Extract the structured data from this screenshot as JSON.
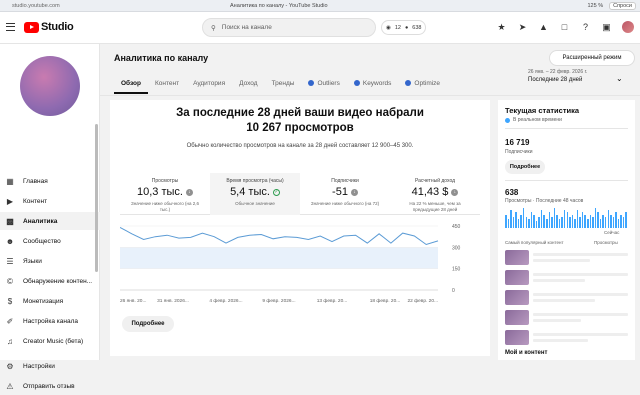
{
  "browser": {
    "url": "studio.youtube.com",
    "title": "Аналитика по каналу - YouTube Studio",
    "zoom": "125 %",
    "ask_label": "Спроси"
  },
  "header": {
    "logo_text": "Studio",
    "search_placeholder": "Поиск на канале",
    "count_a": "12",
    "count_b": "638"
  },
  "sidebar": {
    "items": [
      {
        "label": "Главная",
        "icon": "dashboard-icon"
      },
      {
        "label": "Контент",
        "icon": "content-icon"
      },
      {
        "label": "Аналитика",
        "icon": "analytics-icon"
      },
      {
        "label": "Сообщество",
        "icon": "community-icon"
      },
      {
        "label": "Языки",
        "icon": "languages-icon"
      },
      {
        "label": "Обнаружение контен...",
        "icon": "copyright-icon"
      },
      {
        "label": "Монетизация",
        "icon": "monetization-icon"
      },
      {
        "label": "Настройка канала",
        "icon": "customization-icon"
      },
      {
        "label": "Creator Music (бета)",
        "icon": "music-icon"
      },
      {
        "label": "Настройки",
        "icon": "gear-icon"
      },
      {
        "label": "Отправить отзыв",
        "icon": "feedback-icon"
      }
    ]
  },
  "page": {
    "title": "Аналитика по каналу",
    "advanced_button": "Расширенный режим",
    "date_range": "26 янв. – 22 февр. 2026 г.",
    "date_label": "Последние 28 дней"
  },
  "tabs": [
    {
      "label": "Обзор",
      "dot": false
    },
    {
      "label": "Контент",
      "dot": false
    },
    {
      "label": "Аудитория",
      "dot": false
    },
    {
      "label": "Доход",
      "dot": false
    },
    {
      "label": "Тренды",
      "dot": false
    },
    {
      "label": "Outliers",
      "dot": true
    },
    {
      "label": "Keywords",
      "dot": true
    },
    {
      "label": "Optimize",
      "dot": true
    }
  ],
  "overview": {
    "headline_1": "За последние 28 дней ваши видео набрали",
    "headline_2": "10 267 просмотров",
    "subline": "Обычно количество просмотров на канале за 28 дней составляет 12 900–45 300.",
    "more_button": "Подробнее",
    "metrics": [
      {
        "label": "Просмотры",
        "value": "10,3 тыс.",
        "note": "Значение ниже обычного (на 2,6 тыс.)",
        "status": "down"
      },
      {
        "label": "Время просмотра (часы)",
        "value": "5,4 тыс.",
        "note": "Обычное значение",
        "status": "ok"
      },
      {
        "label": "Подписчики",
        "value": "-51",
        "note": "Значение ниже обычного (на 72)",
        "status": "down"
      },
      {
        "label": "Расчетный доход",
        "value": "41,43 $",
        "note": "На 22 % меньше, чем за предыдущие 28 дней",
        "status": "down"
      }
    ]
  },
  "chart_data": {
    "type": "line",
    "x": [
      "26 янв. 20...",
      "31 янв. 2026...",
      "4 февр. 2026...",
      "9 февр. 2026...",
      "13 февр. 20...",
      "18 февр. 20...",
      "22 февр. 20..."
    ],
    "y_ticks": [
      0,
      150,
      300,
      450
    ],
    "ylim": [
      0,
      450
    ],
    "band": [
      150,
      300
    ],
    "values": [
      440,
      395,
      355,
      375,
      385,
      365,
      370,
      400,
      375,
      330,
      370,
      385,
      390,
      360,
      375,
      370,
      355,
      380,
      340,
      380,
      385,
      330,
      395,
      330,
      400,
      380,
      320,
      345
    ]
  },
  "realtime": {
    "title": "Текущая статистика",
    "live_label": "В реальном времени",
    "subscribers": "16 719",
    "subscribers_label": "Подписчики",
    "button": "Подробнее",
    "views": "638",
    "views_label": "Просмотры · Последние 48 часов",
    "now_label": "Сейчас",
    "popular_label": "Самый популярный контент",
    "views_header": "Просмотры",
    "next_section": "Мой и контент",
    "bars": [
      6,
      4,
      8,
      5,
      7,
      4,
      6,
      9,
      5,
      4,
      7,
      6,
      3,
      5,
      8,
      6,
      4,
      7,
      5,
      9,
      6,
      4,
      5,
      8,
      7,
      5,
      6,
      4,
      8,
      5,
      7,
      6,
      4,
      6,
      5,
      9,
      7,
      4,
      6,
      5,
      8,
      6,
      5,
      7,
      4,
      6,
      5,
      7
    ]
  }
}
